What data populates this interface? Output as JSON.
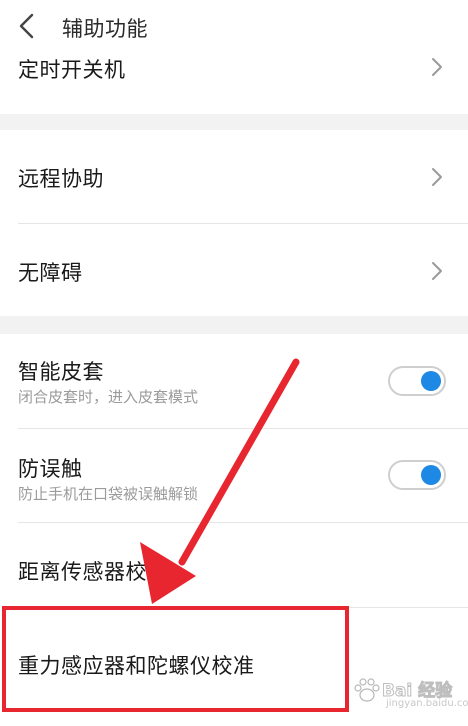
{
  "header": {
    "title": "辅助功能"
  },
  "rows": {
    "timer_power": {
      "label": "定时开关机"
    },
    "remote_assist": {
      "label": "远程协助"
    },
    "accessibility": {
      "label": "无障碍"
    },
    "smart_cover": {
      "label": "智能皮套",
      "sub": "闭合皮套时，进入皮套模式",
      "enabled": true
    },
    "anti_mistouch": {
      "label": "防误触",
      "sub": "防止手机在口袋被误触解锁",
      "enabled": true
    },
    "proximity_calib": {
      "label": "距离传感器校准"
    },
    "gravity_gyro_calib": {
      "label": "重力感应器和陀螺仪校准"
    }
  },
  "watermark": {
    "text": "Bai 经验",
    "sub": "jingyan.baidu.com"
  },
  "colors": {
    "toggle_on": "#1e88e5",
    "annotation": "#e8262f",
    "section_gap": "#f2f2f2"
  }
}
